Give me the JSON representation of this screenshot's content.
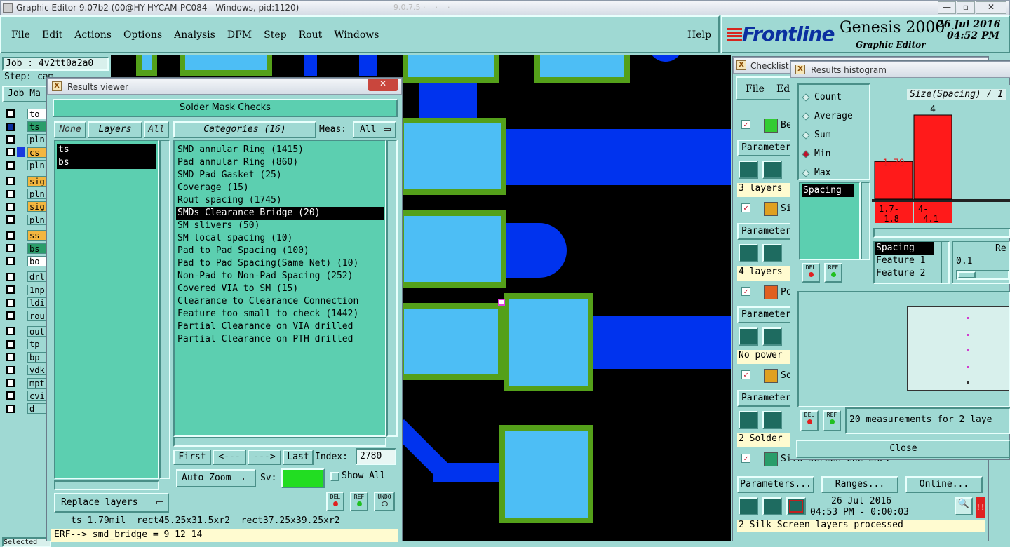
{
  "window": {
    "title": "Graphic Editor 9.07b2 (00@HY-HYCAM-PC084 - Windows, pid:1120)",
    "blurred_title": "9.0.7.5 ·    ·    ·",
    "controls": [
      "—",
      "▫",
      "✕"
    ]
  },
  "menu": {
    "items": [
      "File",
      "Edit",
      "Actions",
      "Options",
      "Analysis",
      "DFM",
      "Step",
      "Rout",
      "Windows"
    ],
    "help": "Help"
  },
  "brand": {
    "logo": "Frontline",
    "product": "Genesis 2000",
    "subtitle": "Graphic Editor",
    "date": "26 Jul 2016",
    "time": "04:52 PM"
  },
  "job": {
    "job_label": "Job : 4v2tt0a2a0",
    "step_label": "Step: cam",
    "matrix_btn": "Job Ma",
    "layers": [
      {
        "name": "to",
        "color": "#ffffff",
        "ck": "□"
      },
      {
        "name": "ts",
        "color": "#2a9d6a",
        "ck": "■"
      },
      {
        "name": "pln",
        "color": "#9fd9d3",
        "ck": "□"
      },
      {
        "name": "cs",
        "color": "#f3b63f",
        "ck": "□"
      },
      {
        "name": "pln",
        "color": "#9fd9d3",
        "ck": "□"
      },
      {
        "name": "sig",
        "color": "#f3b63f",
        "ck": "□"
      },
      {
        "name": "pln",
        "color": "#9fd9d3",
        "ck": "□"
      },
      {
        "name": "sig",
        "color": "#f3b63f",
        "ck": "□"
      },
      {
        "name": "pln",
        "color": "#9fd9d3",
        "ck": "□"
      },
      {
        "name": "ss",
        "color": "#f3b63f",
        "ck": "□"
      },
      {
        "name": "bs",
        "color": "#2a9d6a",
        "ck": "□"
      },
      {
        "name": "bo",
        "color": "#ffffff",
        "ck": "□"
      },
      {
        "name": "drl",
        "color": "#9fd9d3",
        "ck": "□"
      },
      {
        "name": "1np",
        "color": "#9fd9d3",
        "ck": "□"
      },
      {
        "name": "ldi",
        "color": "#9fd9d3",
        "ck": "□"
      },
      {
        "name": "rou",
        "color": "#9fd9d3",
        "ck": "□"
      },
      {
        "name": "out",
        "color": "#9fd9d3",
        "ck": "□"
      },
      {
        "name": "tp",
        "color": "#9fd9d3",
        "ck": "□"
      },
      {
        "name": "bp",
        "color": "#9fd9d3",
        "ck": "□"
      },
      {
        "name": "ydk",
        "color": "#9fd9d3",
        "ck": "□"
      },
      {
        "name": "mpt",
        "color": "#9fd9d3",
        "ck": "□"
      },
      {
        "name": "cvi",
        "color": "#9fd9d3",
        "ck": "□"
      },
      {
        "name": "d",
        "color": "#9fd9d3",
        "ck": "□"
      }
    ],
    "bottom_stub": "Selected"
  },
  "results_viewer": {
    "title": "Results viewer",
    "heading": "Solder Mask Checks",
    "none_btn": "None",
    "layers_btn": "Layers",
    "all_btn": "All",
    "categories_btn": "Categories (16)",
    "meas_label": "Meas:",
    "meas_value": "All",
    "layers": [
      "ts",
      "bs"
    ],
    "categories": [
      "SMD annular Ring (1415)",
      "Pad annular Ring (860)",
      "SMD Pad Gasket (25)",
      "Coverage (15)",
      "Rout spacing (1745)",
      "SMDs Clearance Bridge (20)",
      "SM slivers (50)",
      "SM local spacing (10)",
      "Pad to Pad Spacing (100)",
      "Pad to Pad Spacing(Same Net) (10)",
      "Non-Pad to Non-Pad Spacing (252)",
      "Covered VIA to SM (15)",
      "Clearance to Clearance Connection",
      "Feature too small to check (1442)",
      "Partial Clearance on VIA drilled",
      "Partial Clearance on PTH drilled"
    ],
    "selected_index": 5,
    "first": "First",
    "prev": "<---",
    "next": "--->",
    "last": "Last",
    "index_label": "Index:",
    "index_value": "2780",
    "auto_zoom": "Auto Zoom",
    "sv_label": "Sv:",
    "show_all": "Show All",
    "replace_layers": "Replace layers",
    "del": "DEL",
    "ref": "REF",
    "undo": "UNDO",
    "status": "ts 1.79mil  rect45.25x31.5xr2  rect37.25x39.25xr2",
    "erf": "ERF--> smd_bridge = 9 12 14"
  },
  "checklist": {
    "title": "Checklist",
    "menu": [
      "File",
      "Edi"
    ],
    "rows": [
      {
        "name": "Be",
        "params": "Parameter",
        "info": "3 layers"
      },
      {
        "name": "Si",
        "params": "Parameter",
        "info": "4 layers"
      },
      {
        "name": "Po",
        "params": "Parameter",
        "info": "No power"
      },
      {
        "name": "So",
        "params": "Parameter",
        "info": "2 Solder"
      },
      {
        "name": "Silk Screen Che LRF:",
        "params": "",
        "info": ""
      }
    ],
    "parameters_btn": "Parameters...",
    "ranges_btn": "Ranges...",
    "online_btn": "Online...",
    "date": "26 Jul 2016",
    "time_line": "04:53 PM - 0:00:03",
    "processed": "2 Silk Screen layers processed"
  },
  "histogram": {
    "title": "Results histogram",
    "options": [
      "Count",
      "Average",
      "Sum",
      "Min",
      "Max"
    ],
    "selected_option": "Min",
    "chart_title": "Size(Spacing) / 1",
    "list_item": "Spacing",
    "bars": [
      {
        "label": "1.79",
        "range": "1.7-\n 1.8"
      },
      {
        "label": "4",
        "range": "4-\n 4.1"
      }
    ],
    "fields": [
      "Spacing",
      "Feature 1",
      "Feature 2"
    ],
    "range_label": "Re",
    "range_value": "0.1",
    "del": "DEL",
    "ref": "REF",
    "measurements": "20 measurements for 2 laye",
    "close": "Close"
  },
  "chart_data": {
    "type": "bar",
    "title": "Size(Spacing) / 1",
    "categories": [
      "1.7-1.8",
      "4-4.1"
    ],
    "values": [
      1.79,
      4
    ],
    "value_labels": [
      "1.79",
      "4"
    ]
  },
  "colors": {
    "canvas_bg": "#000000",
    "pad_fill": "#4dbef5",
    "pad_border": "#54a01a",
    "trace": "#0033ee",
    "panel_teal": "#5ccfb0",
    "ui_bg": "#9fd9d3",
    "bar_red": "#ff1a1a"
  }
}
